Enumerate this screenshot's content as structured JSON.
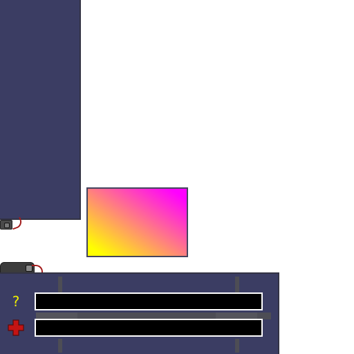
{
  "status": {
    "help_symbol": "?",
    "health_icon": "health-cross-icon"
  },
  "bars": [
    {
      "name": "mystery-bar",
      "fill_fraction": 0
    },
    {
      "name": "health-bar",
      "fill_fraction": 0
    }
  ],
  "colors": {
    "panel_bg": "#3b3d63",
    "panel_border": "#333344",
    "gradient_start": "#ffff00",
    "gradient_end": "#ff00ff",
    "help_color": "#f0f000",
    "health_color": "#c41414",
    "bar_bg": "#000000",
    "bar_border": "#ffffff"
  }
}
